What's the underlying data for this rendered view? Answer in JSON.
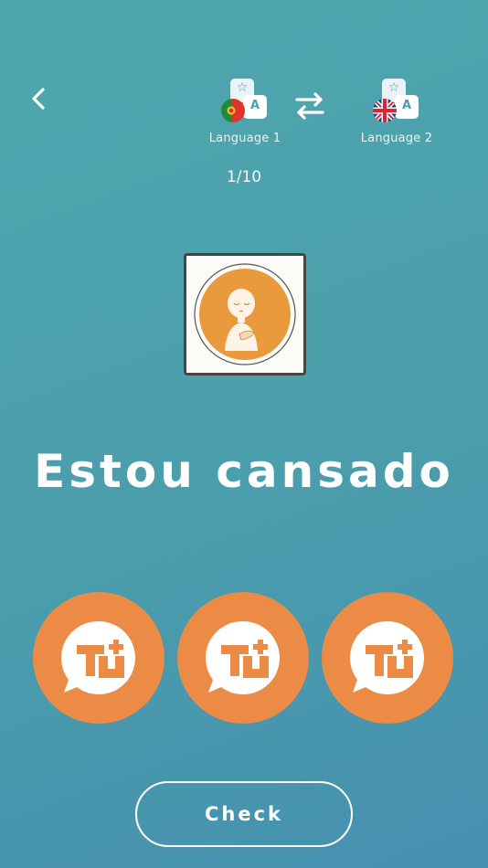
{
  "header": {
    "back_icon": "chevron-left-icon",
    "language1": {
      "label": "Language 1",
      "flag": "portugal-flag",
      "letter": "A",
      "star": "☆"
    },
    "language2": {
      "label": "Language 2",
      "flag": "uk-flag",
      "letter": "A",
      "star": "☆"
    },
    "swap_icon": "swap-arrows-icon"
  },
  "quiz": {
    "progress": "1/10",
    "image": "tired-person-icon",
    "phrase": "Estou cansado"
  },
  "options": [
    {
      "icon": "speech-bubble-logo-icon"
    },
    {
      "icon": "speech-bubble-logo-icon"
    },
    {
      "icon": "speech-bubble-logo-icon"
    }
  ],
  "actions": {
    "check_label": "Check"
  },
  "colors": {
    "background_top": "#4ea7ae",
    "background_bottom": "#4690b0",
    "accent_orange": "#ec8b45",
    "card_orange": "#e99a3c",
    "white": "#ffffff"
  }
}
